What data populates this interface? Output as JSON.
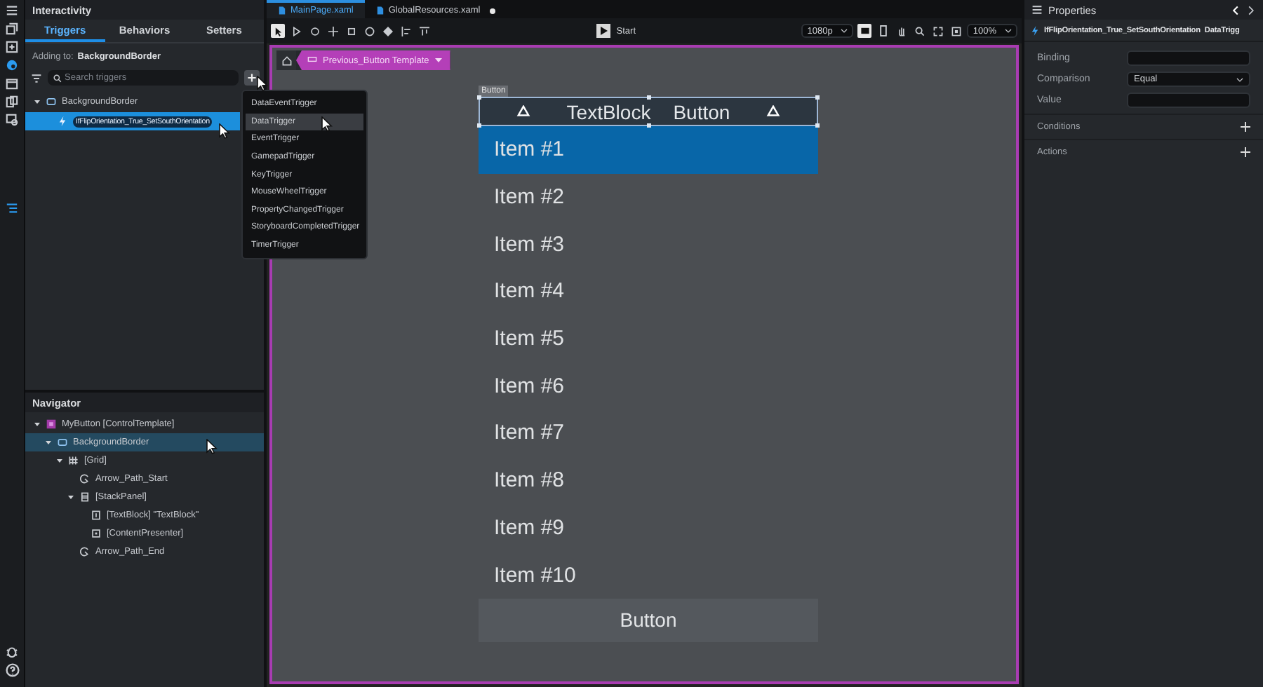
{
  "left_panel": {
    "title": "Interactivity",
    "tabs": [
      {
        "label": "Triggers",
        "selected": true
      },
      {
        "label": "Behaviors",
        "selected": false
      },
      {
        "label": "Setters",
        "selected": false
      }
    ],
    "adding_to": {
      "label": "Adding to:",
      "target": "BackgroundBorder"
    },
    "search": {
      "placeholder": "Search triggers"
    },
    "tree": [
      {
        "label": "BackgroundBorder",
        "kind": "border",
        "expanded": true,
        "selected": false,
        "children": [
          {
            "label": "IfFlipOrientation_True_SetSouthOrientation",
            "kind": "trigger",
            "selected": true
          }
        ]
      }
    ]
  },
  "trigger_menu": {
    "items": [
      {
        "label": "DataEventTrigger",
        "selected": false
      },
      {
        "label": "DataTrigger",
        "selected": true
      },
      {
        "label": "EventTrigger",
        "selected": false
      },
      {
        "label": "GamepadTrigger",
        "selected": false
      },
      {
        "label": "KeyTrigger",
        "selected": false
      },
      {
        "label": "MouseWheelTrigger",
        "selected": false
      },
      {
        "label": "PropertyChangedTrigger",
        "selected": false
      },
      {
        "label": "StoryboardCompletedTrigger",
        "selected": false
      },
      {
        "label": "TimerTrigger",
        "selected": false
      }
    ]
  },
  "navigator": {
    "title": "Navigator",
    "tree": [
      {
        "label": "MyButton [ControlTemplate]",
        "kind": "template",
        "expanded": true,
        "selected": false,
        "children": [
          {
            "label": "BackgroundBorder",
            "kind": "border",
            "expanded": true,
            "selected": true,
            "children": [
              {
                "label": "[Grid]",
                "kind": "grid",
                "expanded": true,
                "selected": false,
                "children": [
                  {
                    "label": "Arrow_Path_Start",
                    "kind": "path",
                    "selected": false
                  },
                  {
                    "label": "[StackPanel]",
                    "kind": "stack",
                    "expanded": true,
                    "selected": false,
                    "children": [
                      {
                        "label": "[TextBlock] \"TextBlock\"",
                        "kind": "text",
                        "selected": false
                      },
                      {
                        "label": "[ContentPresenter]",
                        "kind": "content",
                        "selected": false
                      }
                    ]
                  },
                  {
                    "label": "Arrow_Path_End",
                    "kind": "path",
                    "selected": false
                  }
                ]
              }
            ]
          }
        ]
      }
    ]
  },
  "doc_tabs": [
    {
      "label": "MainPage.xaml",
      "selected": true,
      "modified": false
    },
    {
      "label": "GlobalResources.xaml",
      "selected": false,
      "modified": true
    }
  ],
  "toolbar": {
    "start": "Start",
    "resolution": "1080p",
    "zoom": "100%"
  },
  "breadcrumb": {
    "label": "Previous_Button Template"
  },
  "canvas": {
    "tag": "Button",
    "header_text": "TextBlock",
    "header_button": "Button",
    "items": [
      {
        "label": "Item #1",
        "selected": true
      },
      {
        "label": "Item #2",
        "selected": false
      },
      {
        "label": "Item #3",
        "selected": false
      },
      {
        "label": "Item #4",
        "selected": false
      },
      {
        "label": "Item #5",
        "selected": false
      },
      {
        "label": "Item #6",
        "selected": false
      },
      {
        "label": "Item #7",
        "selected": false
      },
      {
        "label": "Item #8",
        "selected": false
      },
      {
        "label": "Item #9",
        "selected": false
      },
      {
        "label": "Item #10",
        "selected": false
      }
    ],
    "footer_button": "Button"
  },
  "properties": {
    "title": "Properties",
    "trigger_name": "IfFlipOrientation_True_SetSouthOrientation",
    "trigger_type": "DataTrigg",
    "fields": [
      {
        "label": "Binding",
        "kind": "text"
      },
      {
        "label": "Comparison",
        "kind": "dropdown",
        "value": "Equal"
      },
      {
        "label": "Value",
        "kind": "text"
      }
    ],
    "sections": [
      "Conditions",
      "Actions"
    ]
  }
}
